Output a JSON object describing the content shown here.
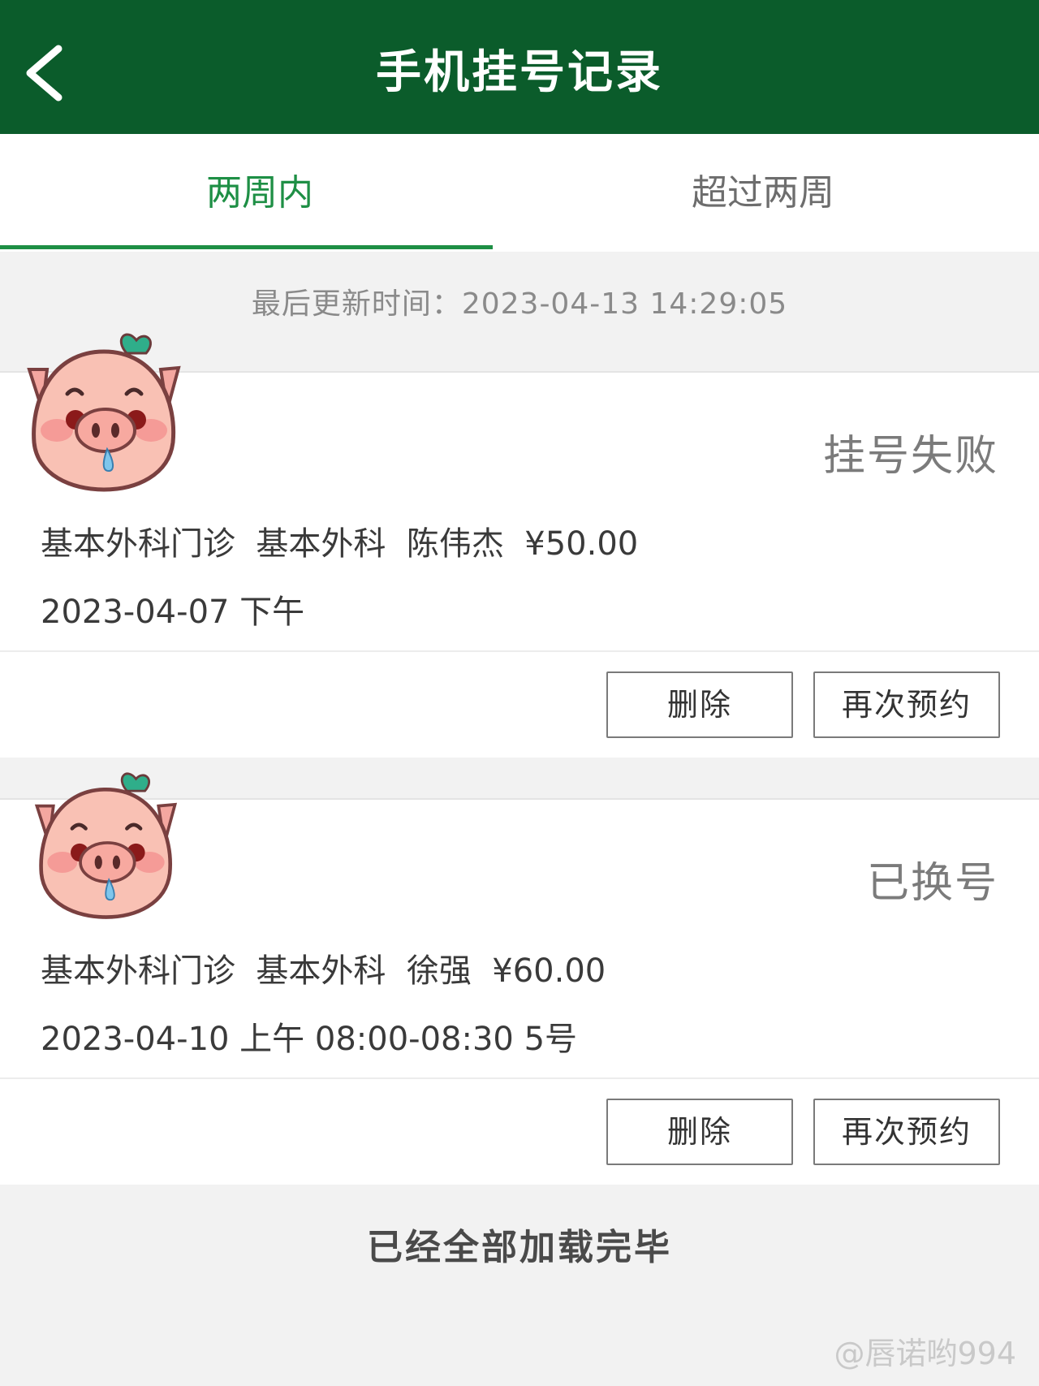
{
  "header": {
    "title": "手机挂号记录",
    "back_icon": "chevron-left-icon"
  },
  "tabs": [
    {
      "label": "两周内",
      "active": true
    },
    {
      "label": "超过两周",
      "active": false
    }
  ],
  "last_updated": "最后更新时间：2023-04-13 14:29:05",
  "records": [
    {
      "status": "挂号失败",
      "line1": "基本外科门诊  基本外科  陈伟杰  ¥50.00",
      "line2": "2023-04-07 下午",
      "delete_label": "删除",
      "rebook_label": "再次预约"
    },
    {
      "status": "已换号",
      "line1": "基本外科门诊  基本外科  徐强  ¥60.00",
      "line2": "2023-04-10 上午 08:00-08:30 5号",
      "delete_label": "删除",
      "rebook_label": "再次预约"
    }
  ],
  "footer": "已经全部加载完毕",
  "watermark": "@唇诺哟994",
  "colors": {
    "header_bg": "#0b5c2b",
    "accent": "#1e8f45"
  }
}
